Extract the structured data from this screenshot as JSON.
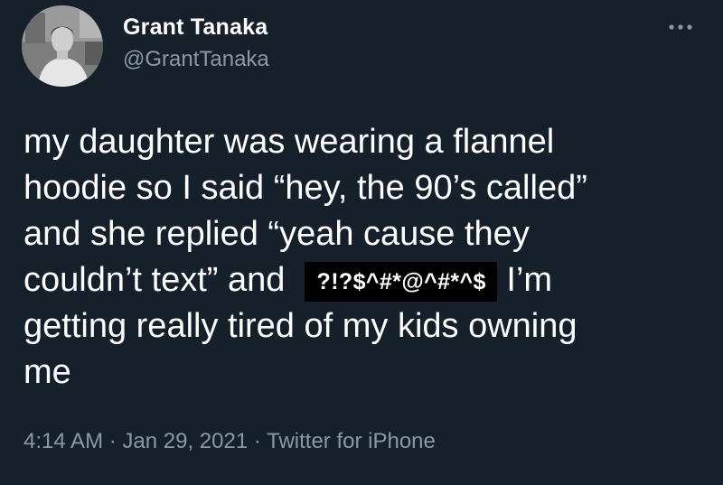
{
  "author": {
    "display_name": "Grant Tanaka",
    "handle": "@GrantTanaka"
  },
  "more_icon": "ellipsis-icon",
  "tweet": {
    "line1": "my daughter was wearing a flannel",
    "line2": "hoodie so I said “hey, the 90’s called”",
    "line3": "and she replied “yeah cause they",
    "line4_start": "couldn’t text” and",
    "censored": "?!?$^#*@^#*^$",
    "line4_end": "I’m",
    "line5": "getting really tired of my kids owning",
    "line6": "me"
  },
  "meta": {
    "time": "4:14 AM",
    "date": "Jan 29, 2021",
    "source": "Twitter for iPhone",
    "separator": "·"
  },
  "colors": {
    "background": "#15202b",
    "primary_text": "#ffffff",
    "secondary_text": "#8b98a5",
    "censor_box": "#000000"
  }
}
